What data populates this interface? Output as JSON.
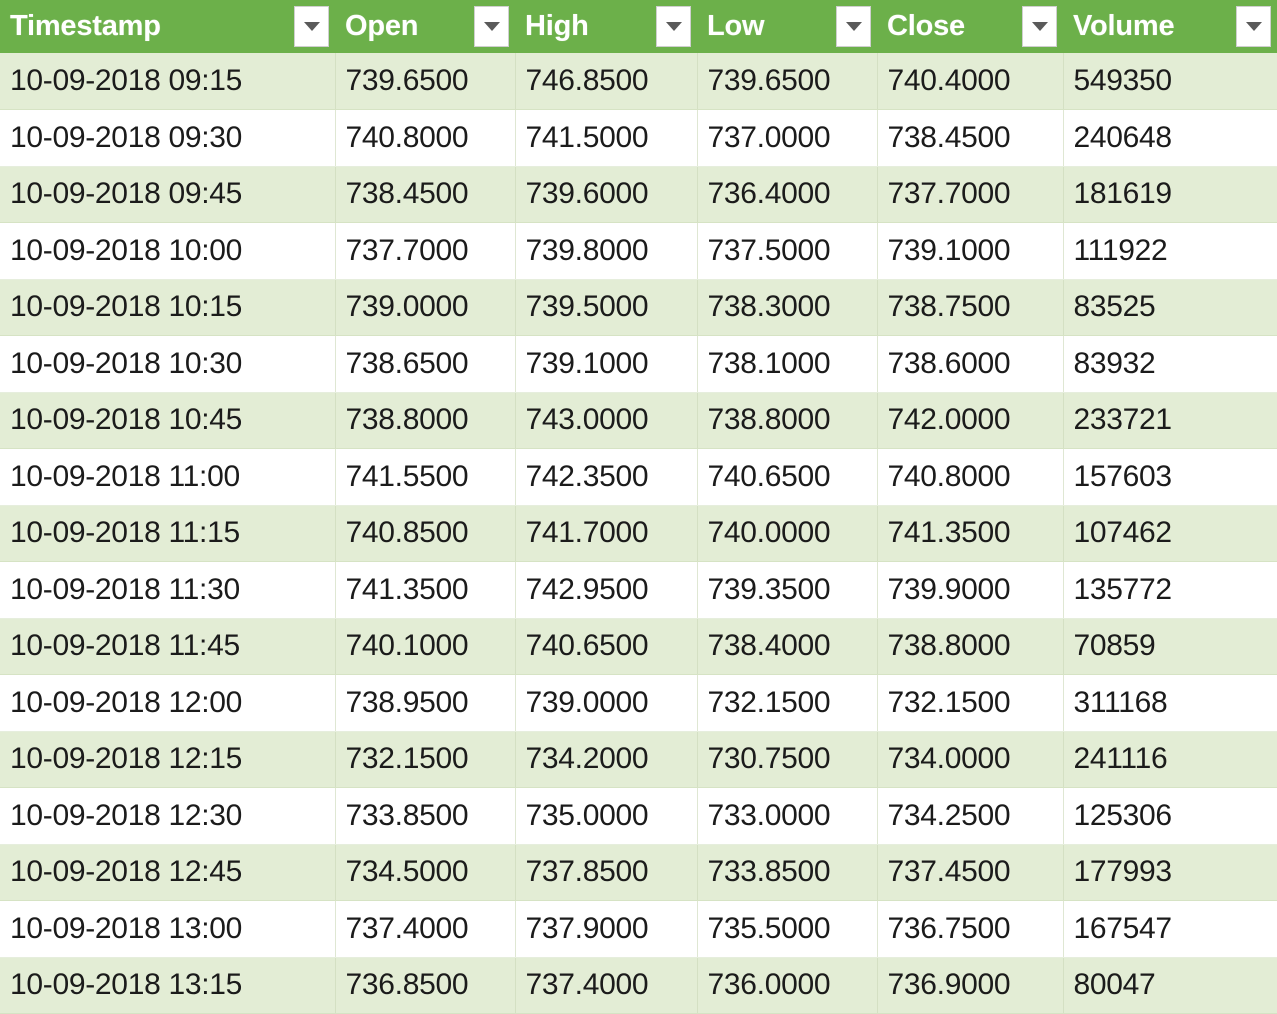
{
  "table": {
    "columns": [
      {
        "key": "timestamp",
        "label": "Timestamp",
        "filter_icon": "filter-dropdown-icon"
      },
      {
        "key": "open",
        "label": "Open",
        "filter_icon": "filter-dropdown-icon"
      },
      {
        "key": "high",
        "label": "High",
        "filter_icon": "filter-dropdown-icon"
      },
      {
        "key": "low",
        "label": "Low",
        "filter_icon": "filter-dropdown-icon"
      },
      {
        "key": "close",
        "label": "Close",
        "filter_icon": "filter-dropdown-icon"
      },
      {
        "key": "volume",
        "label": "Volume",
        "filter_icon": "filter-dropdown-icon"
      }
    ],
    "rows": [
      {
        "timestamp": "10-09-2018 09:15",
        "open": "739.6500",
        "high": "746.8500",
        "low": "739.6500",
        "close": "740.4000",
        "volume": "549350"
      },
      {
        "timestamp": "10-09-2018 09:30",
        "open": "740.8000",
        "high": "741.5000",
        "low": "737.0000",
        "close": "738.4500",
        "volume": "240648"
      },
      {
        "timestamp": "10-09-2018 09:45",
        "open": "738.4500",
        "high": "739.6000",
        "low": "736.4000",
        "close": "737.7000",
        "volume": "181619"
      },
      {
        "timestamp": "10-09-2018 10:00",
        "open": "737.7000",
        "high": "739.8000",
        "low": "737.5000",
        "close": "739.1000",
        "volume": "111922"
      },
      {
        "timestamp": "10-09-2018 10:15",
        "open": "739.0000",
        "high": "739.5000",
        "low": "738.3000",
        "close": "738.7500",
        "volume": "83525"
      },
      {
        "timestamp": "10-09-2018 10:30",
        "open": "738.6500",
        "high": "739.1000",
        "low": "738.1000",
        "close": "738.6000",
        "volume": "83932"
      },
      {
        "timestamp": "10-09-2018 10:45",
        "open": "738.8000",
        "high": "743.0000",
        "low": "738.8000",
        "close": "742.0000",
        "volume": "233721"
      },
      {
        "timestamp": "10-09-2018 11:00",
        "open": "741.5500",
        "high": "742.3500",
        "low": "740.6500",
        "close": "740.8000",
        "volume": "157603"
      },
      {
        "timestamp": "10-09-2018 11:15",
        "open": "740.8500",
        "high": "741.7000",
        "low": "740.0000",
        "close": "741.3500",
        "volume": "107462"
      },
      {
        "timestamp": "10-09-2018 11:30",
        "open": "741.3500",
        "high": "742.9500",
        "low": "739.3500",
        "close": "739.9000",
        "volume": "135772"
      },
      {
        "timestamp": "10-09-2018 11:45",
        "open": "740.1000",
        "high": "740.6500",
        "low": "738.4000",
        "close": "738.8000",
        "volume": "70859"
      },
      {
        "timestamp": "10-09-2018 12:00",
        "open": "738.9500",
        "high": "739.0000",
        "low": "732.1500",
        "close": "732.1500",
        "volume": "311168"
      },
      {
        "timestamp": "10-09-2018 12:15",
        "open": "732.1500",
        "high": "734.2000",
        "low": "730.7500",
        "close": "734.0000",
        "volume": "241116"
      },
      {
        "timestamp": "10-09-2018 12:30",
        "open": "733.8500",
        "high": "735.0000",
        "low": "733.0000",
        "close": "734.2500",
        "volume": "125306"
      },
      {
        "timestamp": "10-09-2018 12:45",
        "open": "734.5000",
        "high": "737.8500",
        "low": "733.8500",
        "close": "737.4500",
        "volume": "177993"
      },
      {
        "timestamp": "10-09-2018 13:00",
        "open": "737.4000",
        "high": "737.9000",
        "low": "735.5000",
        "close": "736.7500",
        "volume": "167547"
      },
      {
        "timestamp": "10-09-2018 13:15",
        "open": "736.8500",
        "high": "737.4000",
        "low": "736.0000",
        "close": "736.9000",
        "volume": "80047"
      }
    ]
  },
  "colors": {
    "header_green": "#6CB04A",
    "row_alt_green": "#E3EDD5",
    "row_white": "#FFFFFF",
    "header_text": "#FFFFFF",
    "cell_text": "#1B1B1B",
    "filter_button_bg": "#FFFFFF",
    "filter_arrow": "#5A5A5A"
  }
}
